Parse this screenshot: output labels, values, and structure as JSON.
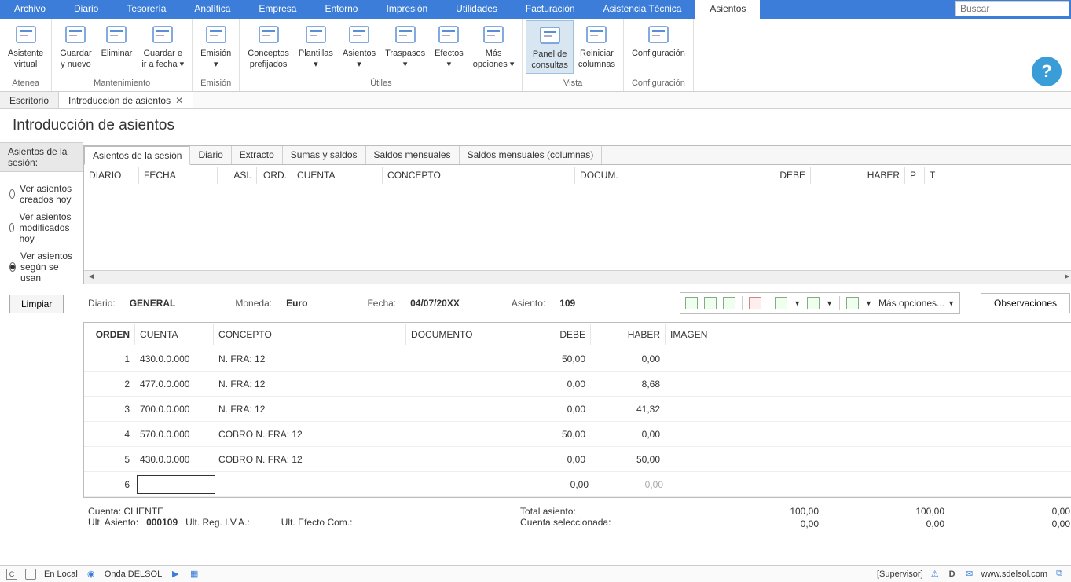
{
  "menu": {
    "items": [
      "Archivo",
      "Diario",
      "Tesorería",
      "Analítica",
      "Empresa",
      "Entorno",
      "Impresión",
      "Utilidades",
      "Facturación",
      "Asistencia Técnica",
      "Asientos"
    ],
    "active": 10,
    "search_placeholder": "Buscar"
  },
  "ribbon": {
    "groups": [
      {
        "label": "Atenea",
        "buttons": [
          {
            "label": "Asistente\nvirtual"
          }
        ]
      },
      {
        "label": "Mantenimiento",
        "buttons": [
          {
            "label": "Guardar\ny nuevo"
          },
          {
            "label": "Eliminar"
          },
          {
            "label": "Guardar e\nir a fecha ▾"
          }
        ]
      },
      {
        "label": "Emisión",
        "buttons": [
          {
            "label": "Emisión\n▾"
          }
        ]
      },
      {
        "label": "Útiles",
        "buttons": [
          {
            "label": "Conceptos\nprefijados"
          },
          {
            "label": "Plantillas\n▾"
          },
          {
            "label": "Asientos\n▾"
          },
          {
            "label": "Traspasos\n▾"
          },
          {
            "label": "Efectos\n▾"
          },
          {
            "label": "Más\nopciones ▾"
          }
        ]
      },
      {
        "label": "Vista",
        "buttons": [
          {
            "label": "Panel de\nconsultas",
            "hl": true
          },
          {
            "label": "Reiniciar\ncolumnas"
          }
        ]
      },
      {
        "label": "Configuración",
        "buttons": [
          {
            "label": "Configuración"
          }
        ]
      }
    ]
  },
  "doctabs": [
    {
      "label": "Escritorio"
    },
    {
      "label": "Introducción de asientos",
      "close": true,
      "active": true
    }
  ],
  "page_title": "Introducción de asientos",
  "sidebar": {
    "title": "Asientos de la sesión:",
    "radios": [
      {
        "label": "Ver asientos creados hoy",
        "checked": false
      },
      {
        "label": "Ver asientos modificados hoy",
        "checked": false
      },
      {
        "label": "Ver asientos según se usan",
        "checked": true
      }
    ],
    "clear": "Limpiar"
  },
  "subtabs": [
    "Asientos de la sesión",
    "Diario",
    "Extracto",
    "Sumas y saldos",
    "Saldos mensuales",
    "Saldos mensuales (columnas)"
  ],
  "grid_cols": [
    "DIARIO",
    "FECHA",
    "ASI.",
    "ORD.",
    "CUENTA",
    "CONCEPTO",
    "DOCUM.",
    "DEBE",
    "HABER",
    "P",
    "T"
  ],
  "info": {
    "diario_l": "Diario:",
    "diario_v": "GENERAL",
    "moneda_l": "Moneda:",
    "moneda_v": "Euro",
    "fecha_l": "Fecha:",
    "fecha_v": "04/07/20XX",
    "asiento_l": "Asiento:",
    "asiento_v": "109",
    "more": "Más opciones...",
    "obs": "Observaciones"
  },
  "entry_cols": {
    "orden": "ORDEN",
    "cuenta": "CUENTA",
    "concepto": "CONCEPTO",
    "documento": "DOCUMENTO",
    "debe": "DEBE",
    "haber": "HABER",
    "imagen": "IMAGEN"
  },
  "rows": [
    {
      "orden": "1",
      "cuenta": "430.0.0.000",
      "concepto": "N. FRA:  12",
      "doc": "",
      "debe": "50,00",
      "haber": "0,00"
    },
    {
      "orden": "2",
      "cuenta": "477.0.0.000",
      "concepto": "N. FRA:  12",
      "doc": "",
      "debe": "0,00",
      "haber": "8,68"
    },
    {
      "orden": "3",
      "cuenta": "700.0.0.000",
      "concepto": "N. FRA:  12",
      "doc": "",
      "debe": "0,00",
      "haber": "41,32"
    },
    {
      "orden": "4",
      "cuenta": "570.0.0.000",
      "concepto": "COBRO N. FRA:  12",
      "doc": "",
      "debe": "50,00",
      "haber": "0,00"
    },
    {
      "orden": "5",
      "cuenta": "430.0.0.000",
      "concepto": "COBRO N. FRA:  12",
      "doc": "",
      "debe": "0,00",
      "haber": "50,00"
    },
    {
      "orden": "6",
      "cuenta": "",
      "concepto": "",
      "doc": "",
      "debe": "0,00",
      "haber": "0,00",
      "sel": true,
      "grey": true
    }
  ],
  "totals": {
    "cuenta_l": "Cuenta:",
    "cuenta_v": "CLIENTE",
    "ult_asi_l": "Ult. Asiento:",
    "ult_asi_v": "000109",
    "ult_reg_l": "Ult. Reg. I.V.A.:",
    "ult_efecto_l": "Ult. Efecto Com.:",
    "total_l": "Total asiento:",
    "cuenta_sel_l": "Cuenta seleccionada:",
    "r1": [
      "100,00",
      "100,00",
      "0,00"
    ],
    "r2": [
      "0,00",
      "0,00",
      "0,00"
    ]
  },
  "status": {
    "local": "En Local",
    "onda": "Onda DELSOL",
    "supervisor": "[Supervisor]",
    "site": "www.sdelsol.com"
  }
}
